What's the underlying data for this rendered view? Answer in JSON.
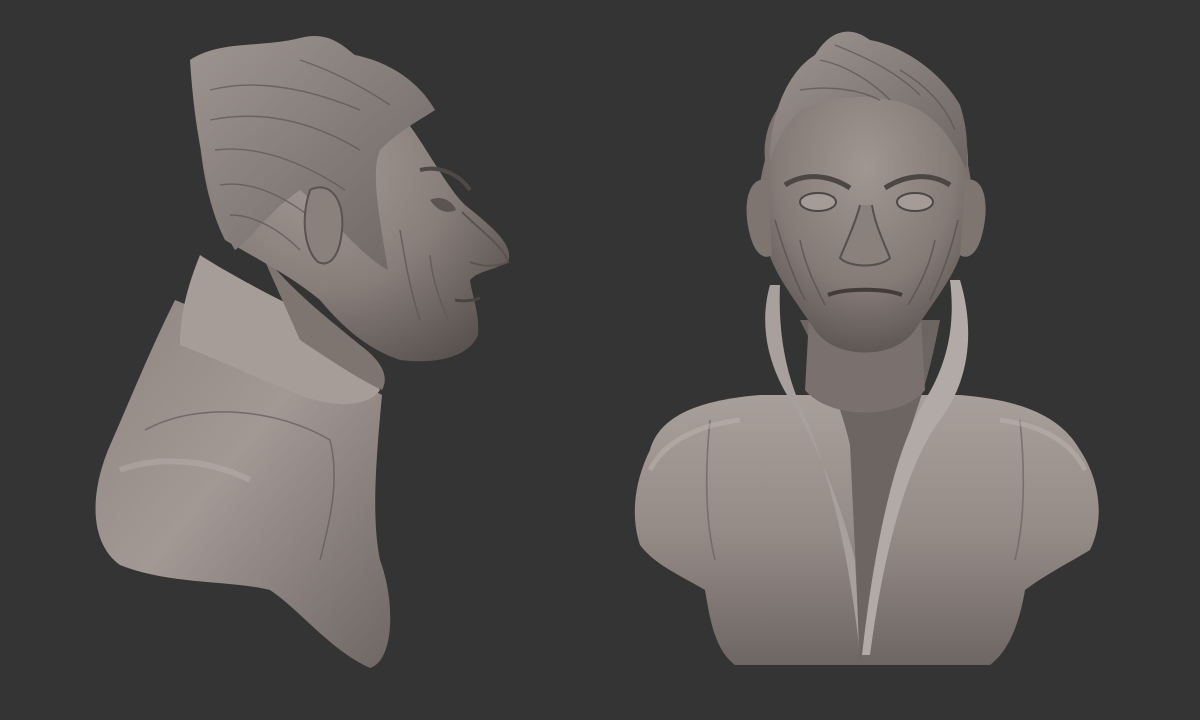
{
  "scene": {
    "background_color": "#343434",
    "material_color": "#8f8581",
    "views": [
      {
        "label_name": "side-profile-bust"
      },
      {
        "label_name": "front-view-bust"
      }
    ]
  }
}
